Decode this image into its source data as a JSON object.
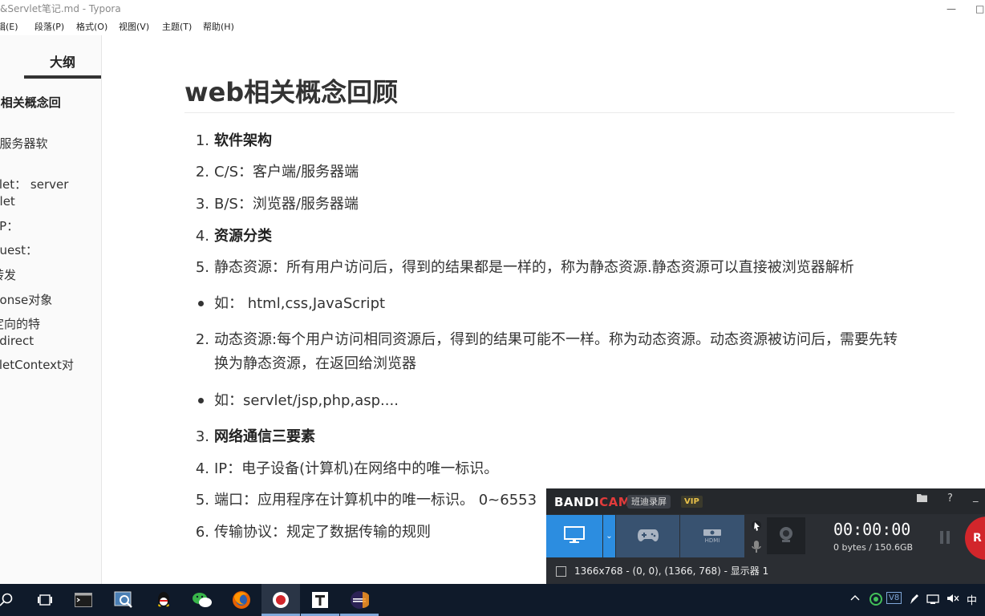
{
  "window": {
    "title": "&Servlet笔记.md - Typora",
    "minimize_glyph": "—",
    "maximize_glyph": "□"
  },
  "menubar": {
    "items": [
      {
        "label": "辑(E)"
      },
      {
        "label": "段落(P)"
      },
      {
        "label": "格式(O)"
      },
      {
        "label": "视图(V)"
      },
      {
        "label": "主题(T)"
      },
      {
        "label": "帮助(H)"
      }
    ]
  },
  "sidebar": {
    "title": "大纲",
    "items": [
      {
        "label": "b相关概念回",
        "level": 1
      },
      {
        "label": "b服务器软",
        "level": 2
      },
      {
        "label": "vlet： server",
        "level": 2
      },
      {
        "label": "blet",
        "level": 2
      },
      {
        "label": "TP：",
        "level": 2
      },
      {
        "label": "quest：",
        "level": 2
      },
      {
        "label": "转发",
        "level": 2
      },
      {
        "label": "ponse对象",
        "level": 2
      },
      {
        "label": "定向的特",
        "level": 2
      },
      {
        "label": "edirect",
        "level": 2
      },
      {
        "label": "vletContext对",
        "level": 2
      },
      {
        "label": "",
        "level": 2
      }
    ],
    "back_glyph": "‹",
    "source_glyph": "</>"
  },
  "document": {
    "title": "web相关概念回顾",
    "lines": [
      {
        "num": "1.",
        "text": "软件架构",
        "bold": true
      },
      {
        "num": "2.",
        "text": "C/S：客户端/服务器端"
      },
      {
        "num": "3.",
        "text": "B/S：浏览器/服务器端"
      },
      {
        "num": "4.",
        "text": "资源分类",
        "bold": true
      },
      {
        "num": "5.",
        "text": "静态资源：所有用户访问后，得到的结果都是一样的，称为静态资源.静态资源可以直接被浏览器解析"
      },
      {
        "bullet": true,
        "text": "如： html,css,JavaScript"
      },
      {
        "num": "2.",
        "text": "动态资源:每个用户访问相同资源后，得到的结果可能不一样。称为动态资源。动态资源被访问后，需要先转"
      },
      {
        "num": "",
        "text": "换为静态资源，在返回给浏览器"
      },
      {
        "bullet": true,
        "text": "如：servlet/jsp,php,asp...."
      },
      {
        "num": "3.",
        "text": "网络通信三要素",
        "bold": true
      },
      {
        "num": "4.",
        "text": "IP：电子设备(计算机)在网络中的唯一标识。"
      },
      {
        "num": "5.",
        "text": "端口：应用程序在计算机中的唯一标识。 0~6553"
      },
      {
        "num": "6.",
        "text": "传输协议：规定了数据传输的规则"
      }
    ]
  },
  "bandicam": {
    "logo_a": "BANDI",
    "logo_b": "CAM",
    "cn_name": "班迪录屏",
    "vip": "VIP",
    "help": "?",
    "minimize": "_",
    "dropdown": "⌄",
    "hdmi_label": "HDMI",
    "timer": "00:00:00",
    "size": "0 bytes / 150.6GB",
    "rec_label": "R",
    "resolution": "1366x768 - (0, 0), (1366, 768) - 显示器 1"
  },
  "taskbar": {
    "ime": "中",
    "tray_v": "V8",
    "accent": "#7fa7d9"
  },
  "colors": {
    "bandicam_blue": "#2c8de0",
    "bandicam_slate": "#385270",
    "record_red": "#d2262b",
    "taskbar_bg": "#0f1a2a"
  }
}
